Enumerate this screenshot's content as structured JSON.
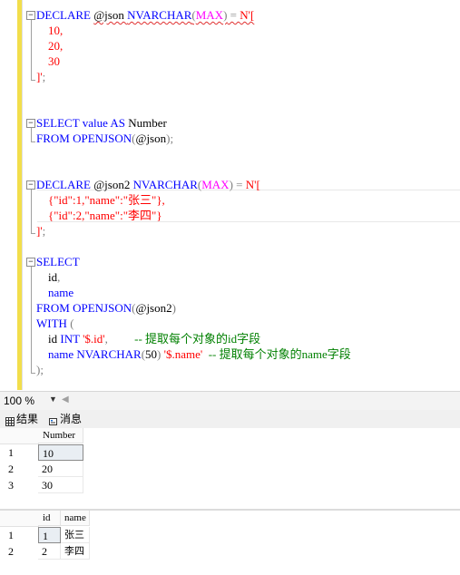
{
  "editor": {
    "lines": [
      {
        "tokens": [
          {
            "t": "DECLARE ",
            "c": "kw"
          },
          {
            "t": "@json ",
            "c": "",
            "sq": true
          },
          {
            "t": "NVARCHAR",
            "c": "kw",
            "sq": true
          },
          {
            "t": "(",
            "c": "gr",
            "sq": true
          },
          {
            "t": "MAX",
            "c": "fn",
            "sq": true
          },
          {
            "t": ")",
            "c": "gr",
            "sq": true
          },
          {
            "t": " = ",
            "c": "gr",
            "sq": true
          },
          {
            "t": "N'[",
            "c": "str",
            "sq": true
          }
        ]
      },
      {
        "tokens": [
          {
            "t": "    10,",
            "c": "str"
          }
        ]
      },
      {
        "tokens": [
          {
            "t": "    20,",
            "c": "str"
          }
        ]
      },
      {
        "tokens": [
          {
            "t": "    30",
            "c": "str"
          }
        ]
      },
      {
        "tokens": [
          {
            "t": "]'",
            "c": "str"
          },
          {
            "t": ";",
            "c": "gr"
          }
        ]
      },
      {
        "tokens": []
      },
      {
        "tokens": []
      },
      {
        "tokens": [
          {
            "t": "SELECT ",
            "c": "kw"
          },
          {
            "t": "value ",
            "c": "kw"
          },
          {
            "t": "AS ",
            "c": "kw"
          },
          {
            "t": "Number",
            "c": ""
          }
        ]
      },
      {
        "tokens": [
          {
            "t": "FROM ",
            "c": "kw"
          },
          {
            "t": "OPENJSON",
            "c": "kw"
          },
          {
            "t": "(",
            "c": "gr"
          },
          {
            "t": "@json",
            "c": ""
          },
          {
            "t": ")",
            "c": "gr"
          },
          {
            "t": ";",
            "c": "gr"
          }
        ]
      },
      {
        "tokens": []
      },
      {
        "tokens": []
      },
      {
        "tokens": [
          {
            "t": "DECLARE ",
            "c": "kw"
          },
          {
            "t": "@json2 ",
            "c": ""
          },
          {
            "t": "NVARCHAR",
            "c": "kw"
          },
          {
            "t": "(",
            "c": "gr"
          },
          {
            "t": "MAX",
            "c": "fn"
          },
          {
            "t": ")",
            "c": "gr"
          },
          {
            "t": " = ",
            "c": "gr"
          },
          {
            "t": "N'[",
            "c": "str"
          }
        ]
      },
      {
        "tokens": [
          {
            "t": "    {\"id\":1,\"name\":\"张三\"},",
            "c": "str"
          }
        ]
      },
      {
        "tokens": [
          {
            "t": "    {\"id\":2,\"name\":\"李四\"}",
            "c": "str"
          }
        ]
      },
      {
        "tokens": [
          {
            "t": "]'",
            "c": "str"
          },
          {
            "t": ";",
            "c": "gr"
          }
        ]
      },
      {
        "tokens": []
      },
      {
        "tokens": [
          {
            "t": "SELECT",
            "c": "kw"
          }
        ]
      },
      {
        "tokens": [
          {
            "t": "    id",
            "c": ""
          },
          {
            "t": ",",
            "c": "gr"
          }
        ]
      },
      {
        "tokens": [
          {
            "t": "    name",
            "c": "kw"
          }
        ]
      },
      {
        "tokens": [
          {
            "t": "FROM ",
            "c": "kw"
          },
          {
            "t": "OPENJSON",
            "c": "kw"
          },
          {
            "t": "(",
            "c": "gr"
          },
          {
            "t": "@json2",
            "c": ""
          },
          {
            "t": ")",
            "c": "gr"
          }
        ]
      },
      {
        "tokens": [
          {
            "t": "WITH ",
            "c": "kw"
          },
          {
            "t": "(",
            "c": "gr"
          }
        ]
      },
      {
        "tokens": [
          {
            "t": "    id ",
            "c": ""
          },
          {
            "t": "INT ",
            "c": "kw"
          },
          {
            "t": "'$.id'",
            "c": "str"
          },
          {
            "t": ",",
            "c": "gr"
          },
          {
            "t": "         ",
            "c": ""
          },
          {
            "t": "-- 提取每个对象的id字段",
            "c": "cm"
          }
        ]
      },
      {
        "tokens": [
          {
            "t": "    name ",
            "c": "kw"
          },
          {
            "t": "NVARCHAR",
            "c": "kw"
          },
          {
            "t": "(",
            "c": "gr"
          },
          {
            "t": "50",
            "c": ""
          },
          {
            "t": ") ",
            "c": "gr"
          },
          {
            "t": "'$.name'",
            "c": "str"
          },
          {
            "t": "  ",
            "c": ""
          },
          {
            "t": "-- 提取每个对象的name字段",
            "c": "cm"
          }
        ]
      },
      {
        "tokens": [
          {
            "t": ")",
            "c": "gr"
          },
          {
            "t": ";",
            "c": "gr"
          }
        ]
      }
    ]
  },
  "statusbar": {
    "zoom": "100 %"
  },
  "tabs": {
    "results_label": "结果",
    "messages_label": "消息"
  },
  "grid1": {
    "columns": [
      "Number"
    ],
    "rows": [
      {
        "num": "1",
        "cells": [
          "10"
        ]
      },
      {
        "num": "2",
        "cells": [
          "20"
        ]
      },
      {
        "num": "3",
        "cells": [
          "30"
        ]
      }
    ]
  },
  "grid2": {
    "columns": [
      "id",
      "name"
    ],
    "rows": [
      {
        "num": "1",
        "cells": [
          "1",
          "张三"
        ]
      },
      {
        "num": "2",
        "cells": [
          "2",
          "李四"
        ]
      }
    ]
  },
  "colors": {
    "keyword": "#0000ff",
    "string": "#ff0000",
    "function": "#ff00ff",
    "comment": "#008000",
    "gutter": "#f2de4c"
  }
}
